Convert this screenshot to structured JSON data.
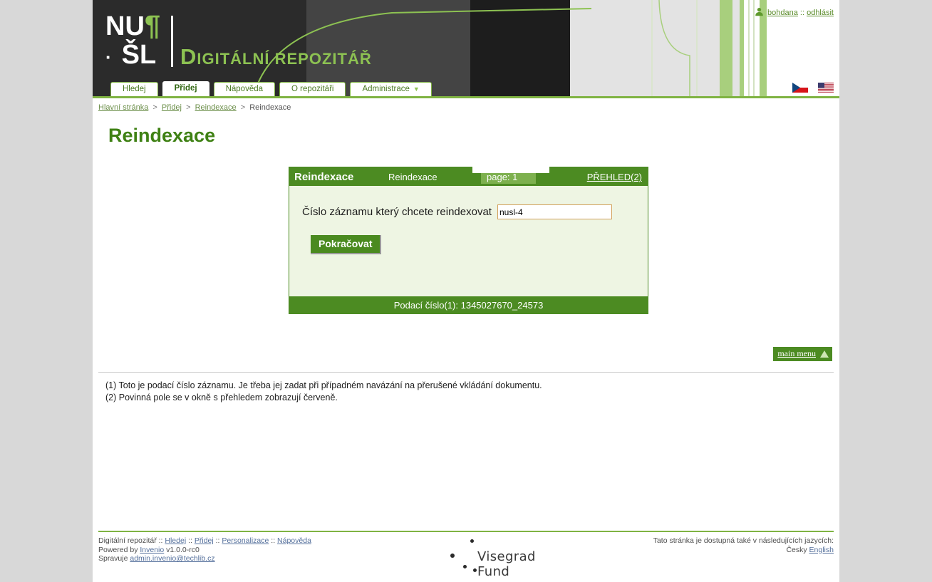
{
  "header": {
    "logo": {
      "line1": "NU",
      "pilcrow": "¶",
      "dot": "·",
      "line2": "ŠL",
      "title_cap": "D",
      "title_rest": "IGITÁLNÍ REPOZITÁŘ"
    },
    "tabs": [
      {
        "label": "Hledej",
        "active": false
      },
      {
        "label": "Přidej",
        "active": true
      },
      {
        "label": "Nápověda",
        "active": false
      },
      {
        "label": "O repozitáři",
        "active": false
      },
      {
        "label": "Administrace",
        "active": false,
        "caret": "▼"
      }
    ],
    "user": {
      "name": "bohdana",
      "separator": "::",
      "logout": "odhlásit",
      "icon": "user-icon"
    },
    "flags": [
      {
        "name": "czech-flag"
      },
      {
        "name": "us-flag"
      }
    ]
  },
  "breadcrumb": {
    "items": [
      "Hlavní stránka",
      "Přidej",
      "Reindexace",
      "Reindexace"
    ],
    "separator": ">"
  },
  "page_title": "Reindexace",
  "panel": {
    "head_title": "Reindexace",
    "head_subtitle": "Reindexace",
    "page_badge": "page: 1",
    "overview_link": "PŘEHLED(2)",
    "form": {
      "label": "Číslo záznamu který chcete reindexovat",
      "input_value": "nusl-4",
      "input_placeholder": "",
      "submit_label": "Pokračovat"
    },
    "footer_text": "Podací číslo(1): 1345027670_24573"
  },
  "main_menu": {
    "label": "main menu",
    "icon": "triangle-up-icon"
  },
  "notes": [
    "(1) Toto je podací číslo záznamu. Je třeba jej zadat při případném navázání na přerušené vkládání dokumentu.",
    "(2) Povinná pole se v okně s přehledem zobrazují červeně."
  ],
  "footer": {
    "line1_prefix": "Digitální repozitář",
    "line1_links": [
      "Hledej",
      "Přidej",
      "Personalizace",
      "Nápověda"
    ],
    "line1_sep": "::",
    "powered_prefix": "Powered by",
    "powered_link": "Invenio",
    "powered_version": "v1.0.0-rc0",
    "admin_prefix": "Spravuje",
    "admin_email": "admin.invenio@techlib.cz",
    "visegrad_text": "Visegrad Fund",
    "lang_notice": "Tato stránka je dostupná také v následujících jazycích:",
    "lang_current": "Česky",
    "lang_other": "English"
  },
  "colors": {
    "brand_green": "#4c8b22",
    "accent_green": "#8dc252",
    "panel_bg": "#eef5e3",
    "page_bg": "#d8d8d8",
    "title_green": "#3f8114",
    "input_border": "#d2a05a"
  }
}
